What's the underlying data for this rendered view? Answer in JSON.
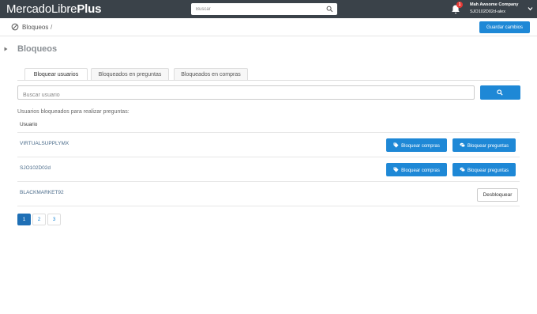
{
  "header": {
    "logo_main": "MercadoLibre",
    "logo_plus": "Plus",
    "search_placeholder": "Buscar",
    "notification_count": "1",
    "company": "Mah Awsome Company",
    "user": "SJO102D02d-alex"
  },
  "breadcrumb": {
    "label": "Bloqueos",
    "separator": "/",
    "save_label": "Guardar cambios"
  },
  "page": {
    "title": "Bloqueos",
    "tabs": [
      {
        "label": "Bloquear usuarios",
        "active": true
      },
      {
        "label": "Bloqueados en preguntas",
        "active": false
      },
      {
        "label": "Bloqueados en compras",
        "active": false
      }
    ],
    "search_placeholder": "Buscar usuario",
    "section_label": "Usuarios bloqueados para realizar preguntas:",
    "column_header": "Usuario"
  },
  "rows": [
    {
      "user": "VIRTUALSUPPLYMX",
      "buttons": [
        "Bloquear compras",
        "Bloquear preguntas"
      ]
    },
    {
      "user": "SJO102D02d",
      "buttons": [
        "Bloquear compras",
        "Bloquear preguntas"
      ]
    },
    {
      "user": "BLACKMARKET92",
      "buttons": [
        "Desbloquear"
      ]
    }
  ],
  "pagination": {
    "pages": [
      "1",
      "2",
      "3"
    ],
    "current": "1"
  },
  "colors": {
    "topbar": "#3a4249",
    "primary": "#1e88d6",
    "page_active": "#1e6fb5"
  },
  "icons": [
    "search-icon",
    "bell-icon",
    "chevron-down-icon",
    "ban-icon",
    "caret-right-icon",
    "tag-icon",
    "chat-icon"
  ]
}
